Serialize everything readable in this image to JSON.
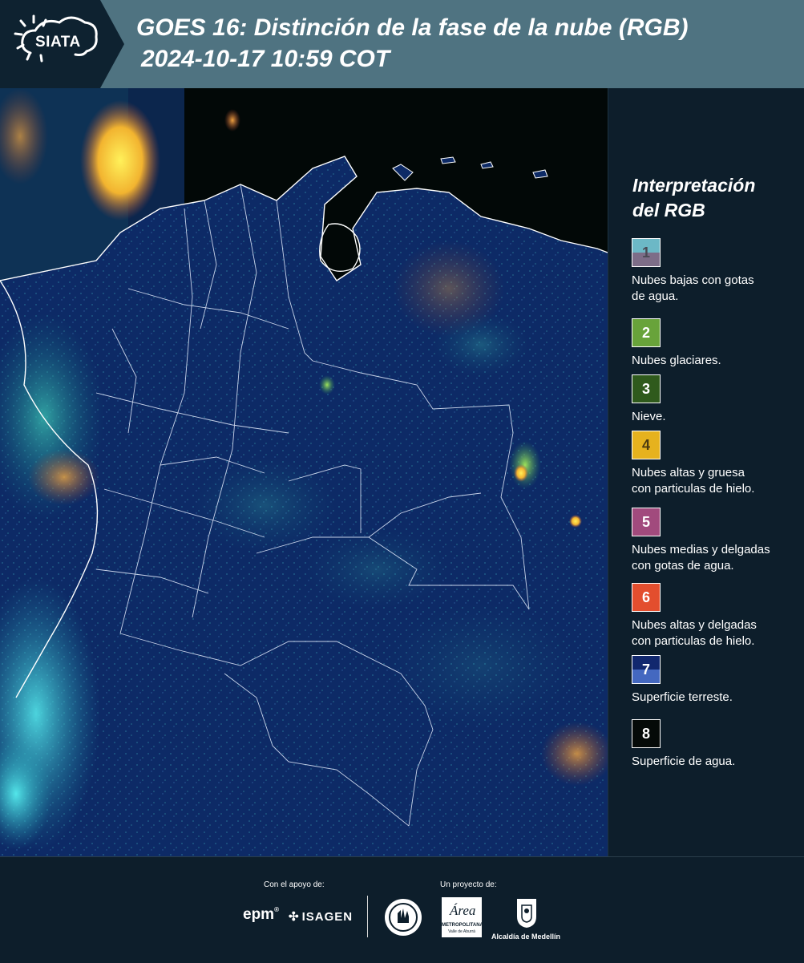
{
  "header": {
    "logo_text": "SIATA",
    "title_line1": "GOES 16: Distinción de la fase de la nube (RGB)",
    "title_line2": "2024-10-17 10:59 COT"
  },
  "legend": {
    "title_line1": "Interpretación",
    "title_line2": "del RGB",
    "items": [
      {
        "num": "1",
        "label_l1": "Nubes bajas con gotas",
        "label_l2": "de agua.",
        "color_top": "#6cb8c6",
        "color_bottom": "#7d6d88",
        "text_color": "#4a4a55"
      },
      {
        "num": "2",
        "label_l1": "Nubes glaciares.",
        "label_l2": "",
        "color_top": "#68a33a",
        "color_bottom": "#68a33a",
        "text_color": "#ffffff"
      },
      {
        "num": "3",
        "label_l1": "Nieve.",
        "label_l2": "",
        "color_top": "#2f5a1c",
        "color_bottom": "#2f5a1c",
        "text_color": "#ffffff"
      },
      {
        "num": "4",
        "label_l1": "Nubes altas y gruesa",
        "label_l2": "con particulas de hielo.",
        "color_top": "#e6b21e",
        "color_bottom": "#e6b21e",
        "text_color": "#4a3a10"
      },
      {
        "num": "5",
        "label_l1": "Nubes medias y delgadas",
        "label_l2": "con gotas de agua.",
        "color_top": "#a14a7d",
        "color_bottom": "#a14a7d",
        "text_color": "#ffffff"
      },
      {
        "num": "6",
        "label_l1": "Nubes altas y delgadas",
        "label_l2": "con particulas de hielo.",
        "color_top": "#e34e2e",
        "color_bottom": "#e34e2e",
        "text_color": "#ffffff"
      },
      {
        "num": "7",
        "label_l1": "Superficie terreste.",
        "label_l2": "",
        "color_top": "#12286e",
        "color_bottom": "#4468c0",
        "text_color": "#ffffff"
      },
      {
        "num": "8",
        "label_l1": "Superficie de agua.",
        "label_l2": "",
        "color_top": "#050a08",
        "color_bottom": "#050a08",
        "text_color": "#ffffff"
      }
    ]
  },
  "footer": {
    "support_label": "Con el apoyo de:",
    "project_label": "Un proyecto de:",
    "sponsor1": "epm",
    "sponsor2": "ISAGEN",
    "area_text": "Área",
    "area_sub1": "METROPOLITANA",
    "area_sub2": "Valle de Aburrá",
    "alcaldia": "Alcaldía de Medellín"
  },
  "colors": {
    "header_bg": "#4f7381",
    "page_bg": "#0d1e2b",
    "land": "#0d2a66",
    "ocean": "#020807"
  }
}
